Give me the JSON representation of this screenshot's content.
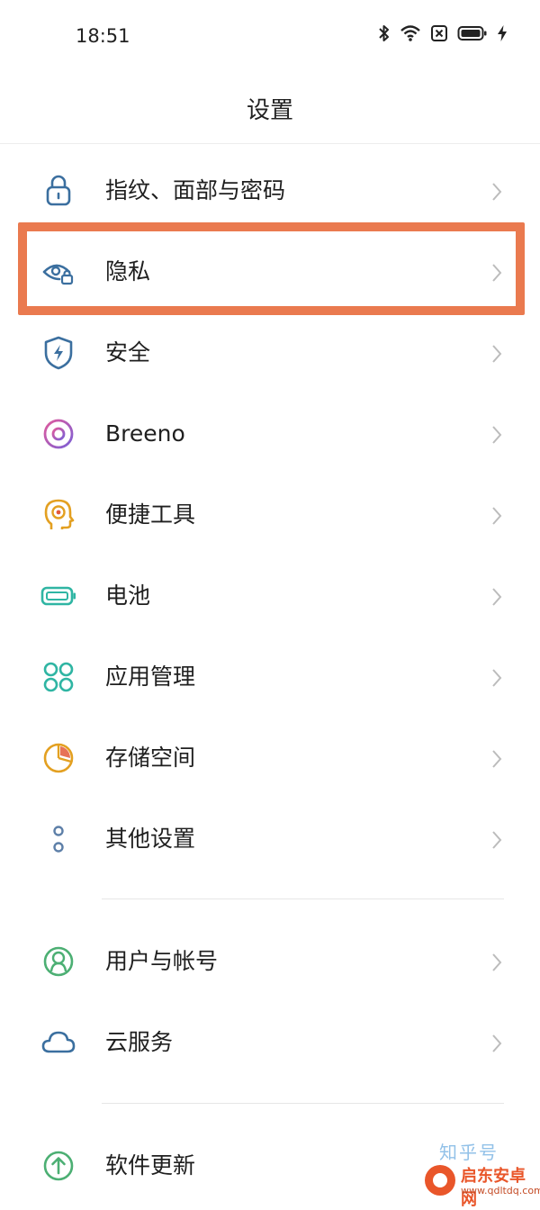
{
  "status_bar": {
    "time": "18:51",
    "icons": [
      "bluetooth-icon",
      "wifi-icon",
      "sim-blocked-icon",
      "battery-icon",
      "charging-icon"
    ]
  },
  "header": {
    "title": "设置"
  },
  "settings": [
    {
      "label": "指纹、面部与密码",
      "icon": "lock-icon",
      "color": "#3b6f9f"
    },
    {
      "label": "隐私",
      "icon": "eye-lock-icon",
      "color": "#3b6f9f",
      "highlighted": true
    },
    {
      "label": "安全",
      "icon": "shield-bolt-icon",
      "color": "#3b6f9f"
    },
    {
      "label": "Breeno",
      "icon": "breeno-ring-icon",
      "color": "#a35bc4"
    },
    {
      "label": "便捷工具",
      "icon": "head-target-icon",
      "color": "#e3a021"
    },
    {
      "label": "电池",
      "icon": "battery-outline-icon",
      "color": "#2fb5a3"
    },
    {
      "label": "应用管理",
      "icon": "app-grid-icon",
      "color": "#2fb5a3"
    },
    {
      "label": "存储空间",
      "icon": "pie-storage-icon",
      "color": "#e3a021"
    },
    {
      "label": "其他设置",
      "icon": "dots-icon",
      "color": "#5d7fa8"
    }
  ],
  "accounts": [
    {
      "label": "用户与帐号",
      "icon": "user-circle-icon",
      "color": "#4caf73"
    },
    {
      "label": "云服务",
      "icon": "cloud-icon",
      "color": "#3b6f9f"
    }
  ],
  "system": [
    {
      "label": "软件更新",
      "icon": "update-arrow-icon",
      "color": "#4caf73"
    }
  ],
  "watermark": {
    "text": "知乎号",
    "site_name": "启东安卓网",
    "site_url": "www.qdltdq.com"
  }
}
